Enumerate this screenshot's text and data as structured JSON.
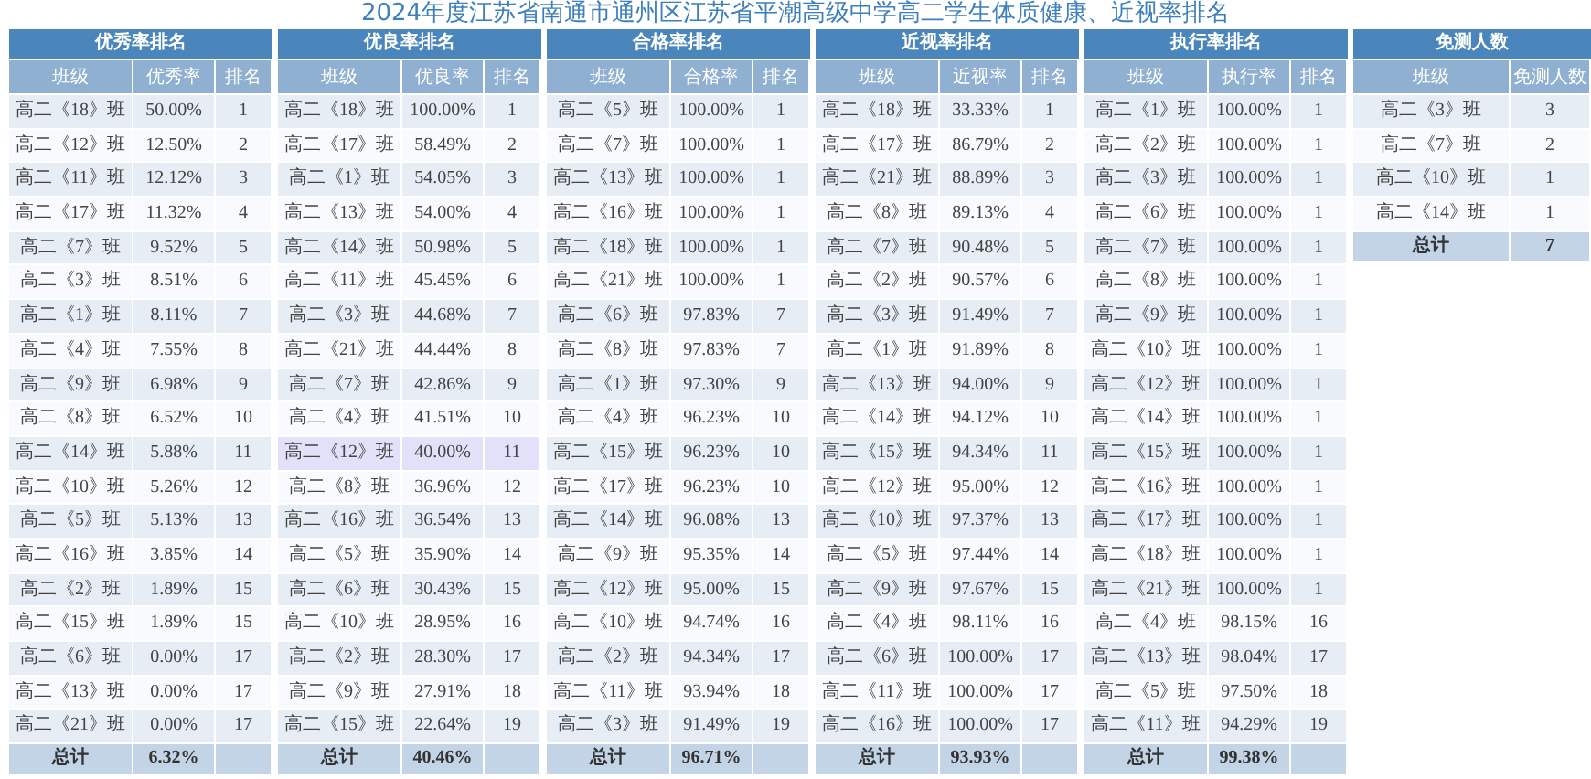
{
  "title": "2024年度江苏省南通市通州区江苏省平潮高级中学高二学生体质健康、近视率排名",
  "tables": [
    {
      "title": "优秀率排名",
      "columns": [
        "班级",
        "优秀率",
        "排名"
      ],
      "rows": [
        {
          "cells": [
            "高二《18》班",
            "50.00%",
            "1"
          ],
          "selected": false
        },
        {
          "cells": [
            "高二《12》班",
            "12.50%",
            "2"
          ],
          "selected": false
        },
        {
          "cells": [
            "高二《11》班",
            "12.12%",
            "3"
          ],
          "selected": false
        },
        {
          "cells": [
            "高二《17》班",
            "11.32%",
            "4"
          ],
          "selected": false
        },
        {
          "cells": [
            "高二《7》班",
            "9.52%",
            "5"
          ],
          "selected": false
        },
        {
          "cells": [
            "高二《3》班",
            "8.51%",
            "6"
          ],
          "selected": false
        },
        {
          "cells": [
            "高二《1》班",
            "8.11%",
            "7"
          ],
          "selected": false
        },
        {
          "cells": [
            "高二《4》班",
            "7.55%",
            "8"
          ],
          "selected": false
        },
        {
          "cells": [
            "高二《9》班",
            "6.98%",
            "9"
          ],
          "selected": false
        },
        {
          "cells": [
            "高二《8》班",
            "6.52%",
            "10"
          ],
          "selected": false
        },
        {
          "cells": [
            "高二《14》班",
            "5.88%",
            "11"
          ],
          "selected": false
        },
        {
          "cells": [
            "高二《10》班",
            "5.26%",
            "12"
          ],
          "selected": false
        },
        {
          "cells": [
            "高二《5》班",
            "5.13%",
            "13"
          ],
          "selected": false
        },
        {
          "cells": [
            "高二《16》班",
            "3.85%",
            "14"
          ],
          "selected": false
        },
        {
          "cells": [
            "高二《2》班",
            "1.89%",
            "15"
          ],
          "selected": false
        },
        {
          "cells": [
            "高二《15》班",
            "1.89%",
            "15"
          ],
          "selected": false
        },
        {
          "cells": [
            "高二《6》班",
            "0.00%",
            "17"
          ],
          "selected": false
        },
        {
          "cells": [
            "高二《13》班",
            "0.00%",
            "17"
          ],
          "selected": false
        },
        {
          "cells": [
            "高二《21》班",
            "0.00%",
            "17"
          ],
          "selected": false
        }
      ],
      "total": [
        "总计",
        "6.32%"
      ]
    },
    {
      "title": "优良率排名",
      "columns": [
        "班级",
        "优良率",
        "排名"
      ],
      "rows": [
        {
          "cells": [
            "高二《18》班",
            "100.00%",
            "1"
          ],
          "selected": false
        },
        {
          "cells": [
            "高二《17》班",
            "58.49%",
            "2"
          ],
          "selected": false
        },
        {
          "cells": [
            "高二《1》班",
            "54.05%",
            "3"
          ],
          "selected": false
        },
        {
          "cells": [
            "高二《13》班",
            "54.00%",
            "4"
          ],
          "selected": false
        },
        {
          "cells": [
            "高二《14》班",
            "50.98%",
            "5"
          ],
          "selected": false
        },
        {
          "cells": [
            "高二《11》班",
            "45.45%",
            "6"
          ],
          "selected": false
        },
        {
          "cells": [
            "高二《3》班",
            "44.68%",
            "7"
          ],
          "selected": false
        },
        {
          "cells": [
            "高二《21》班",
            "44.44%",
            "8"
          ],
          "selected": false
        },
        {
          "cells": [
            "高二《7》班",
            "42.86%",
            "9"
          ],
          "selected": false
        },
        {
          "cells": [
            "高二《4》班",
            "41.51%",
            "10"
          ],
          "selected": false
        },
        {
          "cells": [
            "高二《12》班",
            "40.00%",
            "11"
          ],
          "selected": true
        },
        {
          "cells": [
            "高二《8》班",
            "36.96%",
            "12"
          ],
          "selected": false
        },
        {
          "cells": [
            "高二《16》班",
            "36.54%",
            "13"
          ],
          "selected": false
        },
        {
          "cells": [
            "高二《5》班",
            "35.90%",
            "14"
          ],
          "selected": false
        },
        {
          "cells": [
            "高二《6》班",
            "30.43%",
            "15"
          ],
          "selected": false
        },
        {
          "cells": [
            "高二《10》班",
            "28.95%",
            "16"
          ],
          "selected": false
        },
        {
          "cells": [
            "高二《2》班",
            "28.30%",
            "17"
          ],
          "selected": false
        },
        {
          "cells": [
            "高二《9》班",
            "27.91%",
            "18"
          ],
          "selected": false
        },
        {
          "cells": [
            "高二《15》班",
            "22.64%",
            "19"
          ],
          "selected": false
        }
      ],
      "total": [
        "总计",
        "40.46%"
      ]
    },
    {
      "title": "合格率排名",
      "columns": [
        "班级",
        "合格率",
        "排名"
      ],
      "rows": [
        {
          "cells": [
            "高二《5》班",
            "100.00%",
            "1"
          ],
          "selected": false
        },
        {
          "cells": [
            "高二《7》班",
            "100.00%",
            "1"
          ],
          "selected": false
        },
        {
          "cells": [
            "高二《13》班",
            "100.00%",
            "1"
          ],
          "selected": false
        },
        {
          "cells": [
            "高二《16》班",
            "100.00%",
            "1"
          ],
          "selected": false
        },
        {
          "cells": [
            "高二《18》班",
            "100.00%",
            "1"
          ],
          "selected": false
        },
        {
          "cells": [
            "高二《21》班",
            "100.00%",
            "1"
          ],
          "selected": false
        },
        {
          "cells": [
            "高二《6》班",
            "97.83%",
            "7"
          ],
          "selected": false
        },
        {
          "cells": [
            "高二《8》班",
            "97.83%",
            "7"
          ],
          "selected": false
        },
        {
          "cells": [
            "高二《1》班",
            "97.30%",
            "9"
          ],
          "selected": false
        },
        {
          "cells": [
            "高二《4》班",
            "96.23%",
            "10"
          ],
          "selected": false
        },
        {
          "cells": [
            "高二《15》班",
            "96.23%",
            "10"
          ],
          "selected": false
        },
        {
          "cells": [
            "高二《17》班",
            "96.23%",
            "10"
          ],
          "selected": false
        },
        {
          "cells": [
            "高二《14》班",
            "96.08%",
            "13"
          ],
          "selected": false
        },
        {
          "cells": [
            "高二《9》班",
            "95.35%",
            "14"
          ],
          "selected": false
        },
        {
          "cells": [
            "高二《12》班",
            "95.00%",
            "15"
          ],
          "selected": false
        },
        {
          "cells": [
            "高二《10》班",
            "94.74%",
            "16"
          ],
          "selected": false
        },
        {
          "cells": [
            "高二《2》班",
            "94.34%",
            "17"
          ],
          "selected": false
        },
        {
          "cells": [
            "高二《11》班",
            "93.94%",
            "18"
          ],
          "selected": false
        },
        {
          "cells": [
            "高二《3》班",
            "91.49%",
            "19"
          ],
          "selected": false
        }
      ],
      "total": [
        "总计",
        "96.71%"
      ]
    },
    {
      "title": "近视率排名",
      "columns": [
        "班级",
        "近视率",
        "排名"
      ],
      "rows": [
        {
          "cells": [
            "高二《18》班",
            "33.33%",
            "1"
          ],
          "selected": false
        },
        {
          "cells": [
            "高二《17》班",
            "86.79%",
            "2"
          ],
          "selected": false
        },
        {
          "cells": [
            "高二《21》班",
            "88.89%",
            "3"
          ],
          "selected": false
        },
        {
          "cells": [
            "高二《8》班",
            "89.13%",
            "4"
          ],
          "selected": false
        },
        {
          "cells": [
            "高二《7》班",
            "90.48%",
            "5"
          ],
          "selected": false
        },
        {
          "cells": [
            "高二《2》班",
            "90.57%",
            "6"
          ],
          "selected": false
        },
        {
          "cells": [
            "高二《3》班",
            "91.49%",
            "7"
          ],
          "selected": false
        },
        {
          "cells": [
            "高二《1》班",
            "91.89%",
            "8"
          ],
          "selected": false
        },
        {
          "cells": [
            "高二《13》班",
            "94.00%",
            "9"
          ],
          "selected": false
        },
        {
          "cells": [
            "高二《14》班",
            "94.12%",
            "10"
          ],
          "selected": false
        },
        {
          "cells": [
            "高二《15》班",
            "94.34%",
            "11"
          ],
          "selected": false
        },
        {
          "cells": [
            "高二《12》班",
            "95.00%",
            "12"
          ],
          "selected": false
        },
        {
          "cells": [
            "高二《10》班",
            "97.37%",
            "13"
          ],
          "selected": false
        },
        {
          "cells": [
            "高二《5》班",
            "97.44%",
            "14"
          ],
          "selected": false
        },
        {
          "cells": [
            "高二《9》班",
            "97.67%",
            "15"
          ],
          "selected": false
        },
        {
          "cells": [
            "高二《4》班",
            "98.11%",
            "16"
          ],
          "selected": false
        },
        {
          "cells": [
            "高二《6》班",
            "100.00%",
            "17"
          ],
          "selected": false
        },
        {
          "cells": [
            "高二《11》班",
            "100.00%",
            "17"
          ],
          "selected": false
        },
        {
          "cells": [
            "高二《16》班",
            "100.00%",
            "17"
          ],
          "selected": false
        }
      ],
      "total": [
        "总计",
        "93.93%"
      ]
    },
    {
      "title": "执行率排名",
      "columns": [
        "班级",
        "执行率",
        "排名"
      ],
      "rows": [
        {
          "cells": [
            "高二《1》班",
            "100.00%",
            "1"
          ],
          "selected": false
        },
        {
          "cells": [
            "高二《2》班",
            "100.00%",
            "1"
          ],
          "selected": false
        },
        {
          "cells": [
            "高二《3》班",
            "100.00%",
            "1"
          ],
          "selected": false
        },
        {
          "cells": [
            "高二《6》班",
            "100.00%",
            "1"
          ],
          "selected": false
        },
        {
          "cells": [
            "高二《7》班",
            "100.00%",
            "1"
          ],
          "selected": false
        },
        {
          "cells": [
            "高二《8》班",
            "100.00%",
            "1"
          ],
          "selected": false
        },
        {
          "cells": [
            "高二《9》班",
            "100.00%",
            "1"
          ],
          "selected": false
        },
        {
          "cells": [
            "高二《10》班",
            "100.00%",
            "1"
          ],
          "selected": false
        },
        {
          "cells": [
            "高二《12》班",
            "100.00%",
            "1"
          ],
          "selected": false
        },
        {
          "cells": [
            "高二《14》班",
            "100.00%",
            "1"
          ],
          "selected": false
        },
        {
          "cells": [
            "高二《15》班",
            "100.00%",
            "1"
          ],
          "selected": false
        },
        {
          "cells": [
            "高二《16》班",
            "100.00%",
            "1"
          ],
          "selected": false
        },
        {
          "cells": [
            "高二《17》班",
            "100.00%",
            "1"
          ],
          "selected": false
        },
        {
          "cells": [
            "高二《18》班",
            "100.00%",
            "1"
          ],
          "selected": false
        },
        {
          "cells": [
            "高二《21》班",
            "100.00%",
            "1"
          ],
          "selected": false
        },
        {
          "cells": [
            "高二《4》班",
            "98.15%",
            "16"
          ],
          "selected": false
        },
        {
          "cells": [
            "高二《13》班",
            "98.04%",
            "17"
          ],
          "selected": false
        },
        {
          "cells": [
            "高二《5》班",
            "97.50%",
            "18"
          ],
          "selected": false
        },
        {
          "cells": [
            "高二《11》班",
            "94.29%",
            "19"
          ],
          "selected": false
        }
      ],
      "total": [
        "总计",
        "99.38%"
      ]
    },
    {
      "title": "免测人数",
      "columns": [
        "班级",
        "免测人数"
      ],
      "rows": [
        {
          "cells": [
            "高二《3》班",
            "3"
          ],
          "selected": false
        },
        {
          "cells": [
            "高二《7》班",
            "2"
          ],
          "selected": false
        },
        {
          "cells": [
            "高二《10》班",
            "1"
          ],
          "selected": false
        },
        {
          "cells": [
            "高二《14》班",
            "1"
          ],
          "selected": false
        }
      ],
      "total": [
        "总计",
        "7"
      ]
    }
  ]
}
